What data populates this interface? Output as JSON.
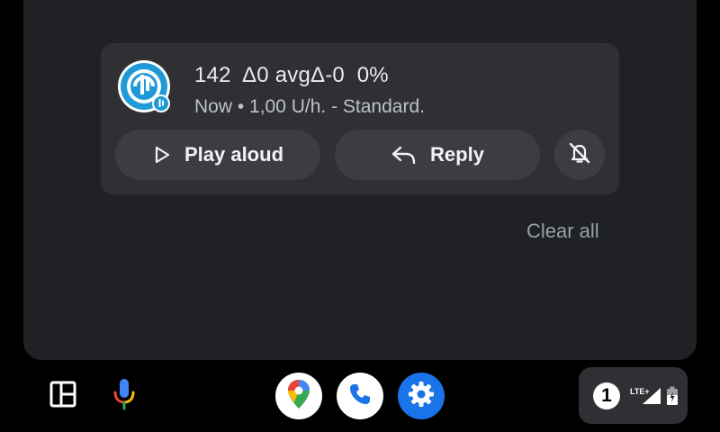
{
  "notification": {
    "title": "142  Δ0 avgΔ-0  0%",
    "subtitle": "Now • 1,00 U/h. - Standard.",
    "app_icon": "glucose-app-icon",
    "actions": {
      "play_label": "Play aloud",
      "reply_label": "Reply"
    },
    "mute_icon": "notifications-off-icon"
  },
  "shade": {
    "clear_all_label": "Clear all"
  },
  "dock": {
    "launcher_icon": "app-launcher-icon",
    "mic_icon": "microphone-icon",
    "apps": [
      "maps-icon",
      "phone-icon",
      "settings-icon"
    ]
  },
  "status": {
    "notification_count": "1",
    "network": "LTE+",
    "signal_icon": "cell-signal-icon",
    "battery_icon": "battery-charging-icon"
  },
  "colors": {
    "shade_bg": "#202124",
    "card_bg": "#2f3033",
    "button_bg": "#3c3d40",
    "accent_blue": "#1a73e8"
  }
}
